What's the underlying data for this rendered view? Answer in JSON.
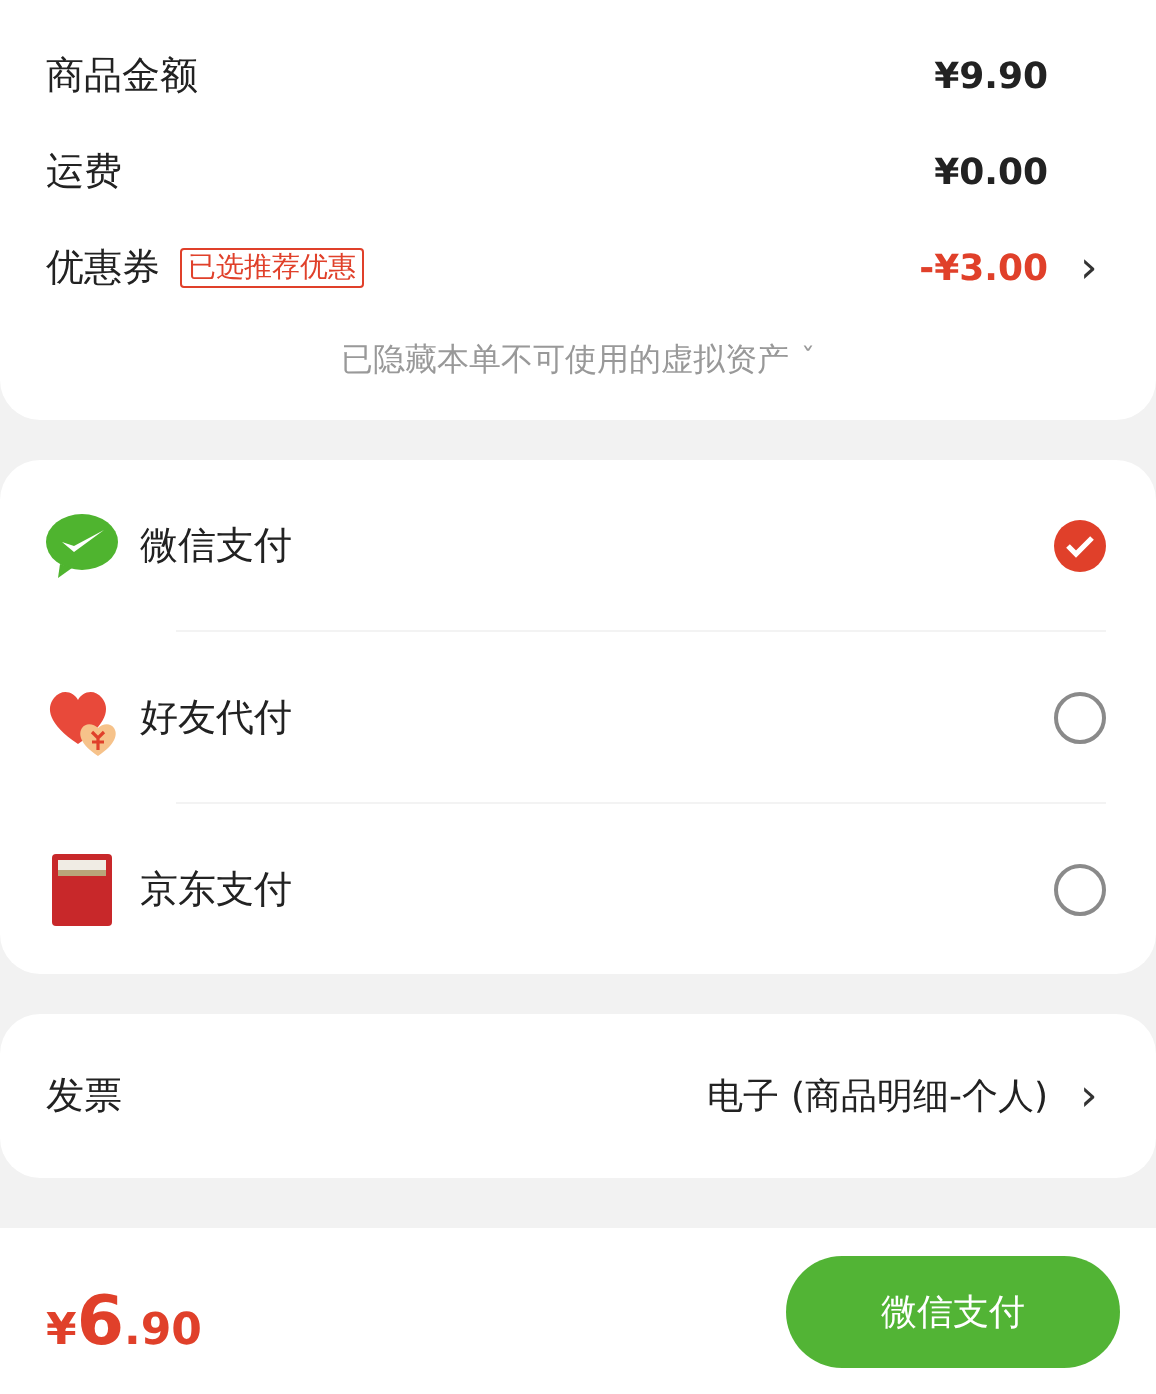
{
  "summary": {
    "rows": [
      {
        "kind": "plain",
        "label": "商品金额",
        "value": "¥9.90"
      },
      {
        "kind": "plain",
        "label": "运费",
        "value": "¥0.00"
      },
      {
        "kind": "coupon",
        "label": "优惠券",
        "tag": "已选推荐优惠",
        "value": "-¥3.00",
        "chevron": "›"
      }
    ],
    "note": "已隐藏本单不可使用的虚拟资产",
    "note_caret": "ˇ"
  },
  "payment_methods": [
    {
      "kind": "wechat",
      "label": "微信支付",
      "selected": true
    },
    {
      "kind": "friend",
      "label": "好友代付",
      "selected": false
    },
    {
      "kind": "card",
      "label": "京东支付",
      "selected": false
    }
  ],
  "invoice": {
    "label": "发票",
    "value": "电子 (商品明细-个人)",
    "chevron": "›"
  },
  "footer": {
    "currency": "¥",
    "integer": "6",
    "decimal": ".90",
    "pay_button": "微信支付"
  }
}
